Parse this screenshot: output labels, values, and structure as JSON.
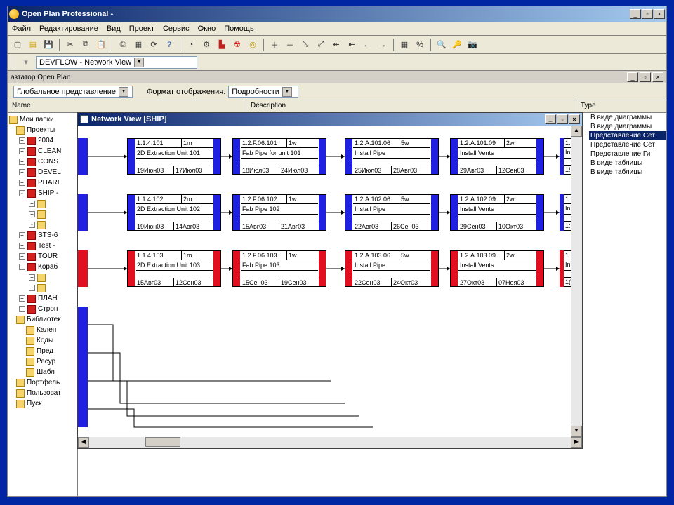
{
  "app": {
    "title": "Open Plan Professional -"
  },
  "menu": [
    "Файл",
    "Редактирование",
    "Вид",
    "Проект",
    "Сервис",
    "Окно",
    "Помощь"
  ],
  "combo_main": "DEVFLOW - Network View",
  "nav_title": "азтатор Open Plan",
  "view": {
    "rep_label": "Глобальное представление",
    "fmt_label": "Формат отображения:",
    "fmt_value": "Подробности"
  },
  "columns": {
    "name": "Name",
    "desc": "Description",
    "type": "Type"
  },
  "tree": {
    "root": "Мои папки",
    "n1": "Проекты",
    "items": [
      "2004",
      "CLEAN",
      "CONS",
      "DEVEL",
      "PHARI",
      "SHIP -",
      "STS-6",
      "Test -",
      "TOUR",
      "Кораб",
      "ПЛАН",
      "Строн"
    ],
    "lib": "Библиотек",
    "libitems": [
      "Кален",
      "Коды",
      "Пред",
      "Ресур",
      "Шабл"
    ],
    "tail": [
      "Портфель",
      "Пользоват",
      "Пуск"
    ]
  },
  "types": [
    "В виде диаграммы",
    "В виде диаграммы",
    "Представление Сет",
    "Представление Сет",
    "Представление Ги",
    "В виде таблицы",
    "В виде таблицы"
  ],
  "types_sel": 2,
  "child": {
    "title": "Network View [SHIP]"
  },
  "tasks": [
    [
      {
        "id": "1.1.4.101",
        "dur": "1m",
        "name": "2D Extraction Unit 101",
        "s": "19Июн03",
        "e": "17Июл03",
        "c": "blue"
      },
      {
        "id": "1.2.F.06.101",
        "dur": "1w",
        "name": "Fab Pipe for unit 101",
        "s": "18Июл03",
        "e": "24Июл03",
        "c": "blue"
      },
      {
        "id": "1.2.A.101.06",
        "dur": "5w",
        "name": "Install Pipe",
        "s": "25Июл03",
        "e": "28Авг03",
        "c": "blue"
      },
      {
        "id": "1.2.A.101.09",
        "dur": "2w",
        "name": "Install Vents",
        "s": "29Авг03",
        "e": "12Сен03",
        "c": "blue"
      }
    ],
    [
      {
        "id": "1.1.4.102",
        "dur": "2m",
        "name": "2D Extraction Unit 102",
        "s": "19Июн03",
        "e": "14Авг03",
        "c": "blue"
      },
      {
        "id": "1.2.F.06.102",
        "dur": "1w",
        "name": "Fab Pipe 102",
        "s": "15Авг03",
        "e": "21Авг03",
        "c": "blue"
      },
      {
        "id": "1.2.A.102.06",
        "dur": "5w",
        "name": "Install Pipe",
        "s": "22Авг03",
        "e": "26Сен03",
        "c": "blue"
      },
      {
        "id": "1.2.A.102.09",
        "dur": "2w",
        "name": "Install Vents",
        "s": "29Сен03",
        "e": "10Окт03",
        "c": "blue"
      }
    ],
    [
      {
        "id": "1.1.4.103",
        "dur": "1m",
        "name": "2D Extraction Unit 103",
        "s": "15Авг03",
        "e": "12Сен03",
        "c": "red"
      },
      {
        "id": "1.2.F.06.103",
        "dur": "1w",
        "name": "Fab Pipe 103",
        "s": "15Сен03",
        "e": "19Сен03",
        "c": "red"
      },
      {
        "id": "1.2.A.103.06",
        "dur": "5w",
        "name": "Install Pipe",
        "s": "22Сен03",
        "e": "24Окт03",
        "c": "red"
      },
      {
        "id": "1.2.A.103.09",
        "dur": "2w",
        "name": "Install Vents",
        "s": "27Окт03",
        "e": "07Ноя03",
        "c": "red"
      }
    ]
  ],
  "frag": [
    {
      "row": 0,
      "c": "blue",
      "id": "1.",
      "name": "In",
      "s": "1!"
    },
    {
      "row": 1,
      "c": "blue",
      "id": "1.",
      "name": "In",
      "s": "1:"
    },
    {
      "row": 2,
      "c": "red",
      "id": "1.",
      "name": "In",
      "s": "1("
    }
  ]
}
